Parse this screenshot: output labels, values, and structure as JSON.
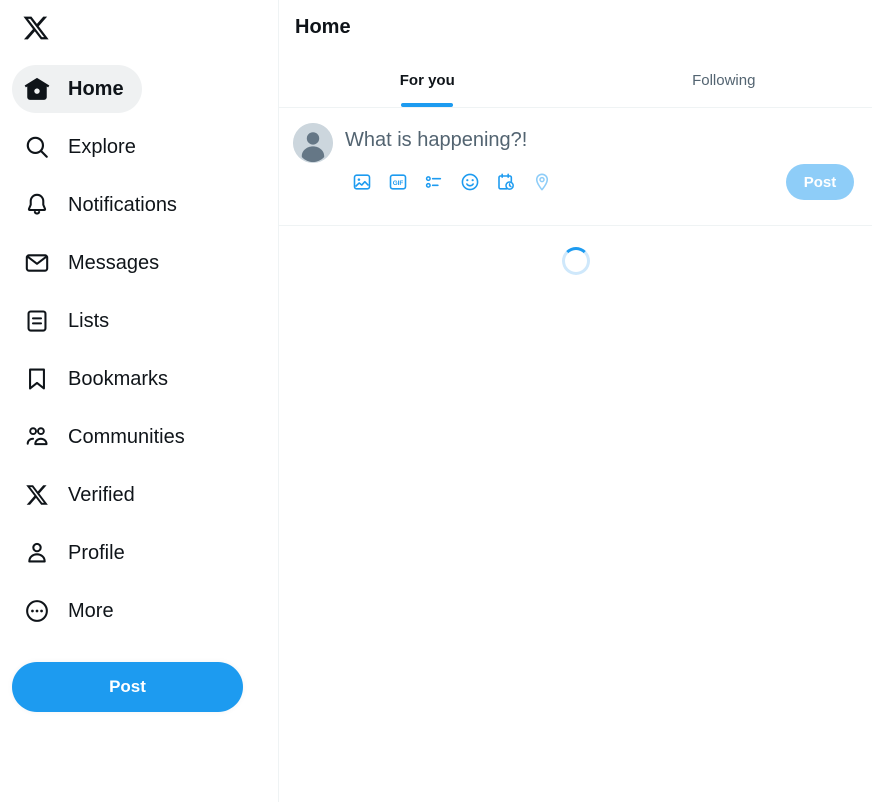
{
  "app": {
    "brand_icon": "x-logo-icon",
    "accent_color": "#1d9bf0",
    "accent_muted_color": "#8ecdf8",
    "text_color": "#0f1419",
    "secondary_text_color": "#536471",
    "active_pill_color": "#eff1f2",
    "divider_color": "#eff3f4"
  },
  "sidebar": {
    "items": [
      {
        "label": "Home",
        "icon": "home-icon",
        "active": true
      },
      {
        "label": "Explore",
        "icon": "search-icon",
        "active": false
      },
      {
        "label": "Notifications",
        "icon": "bell-icon",
        "active": false
      },
      {
        "label": "Messages",
        "icon": "envelope-icon",
        "active": false
      },
      {
        "label": "Lists",
        "icon": "list-icon",
        "active": false
      },
      {
        "label": "Bookmarks",
        "icon": "bookmark-icon",
        "active": false
      },
      {
        "label": "Communities",
        "icon": "communities-icon",
        "active": false
      },
      {
        "label": "Verified",
        "icon": "x-badge-icon",
        "active": false
      },
      {
        "label": "Profile",
        "icon": "person-icon",
        "active": false
      },
      {
        "label": "More",
        "icon": "more-circle-icon",
        "active": false
      }
    ],
    "post_button_label": "Post"
  },
  "main": {
    "header": {
      "title": "Home"
    },
    "tabs": [
      {
        "label": "For you",
        "active": true
      },
      {
        "label": "Following",
        "active": false
      }
    ],
    "compose": {
      "avatar_icon": "default-avatar-icon",
      "placeholder": "What is happening?!",
      "value": "",
      "tools": [
        {
          "name": "media-icon",
          "label": "Media",
          "disabled": false
        },
        {
          "name": "gif-icon",
          "label": "GIF",
          "disabled": false
        },
        {
          "name": "poll-icon",
          "label": "Poll",
          "disabled": false
        },
        {
          "name": "emoji-icon",
          "label": "Emoji",
          "disabled": false
        },
        {
          "name": "schedule-icon",
          "label": "Schedule",
          "disabled": false
        },
        {
          "name": "location-icon",
          "label": "Tag location",
          "disabled": true
        }
      ],
      "post_button_label": "Post",
      "post_button_enabled": false
    },
    "feed": {
      "status": "loading",
      "spinner_icon": "loading-spinner-icon"
    }
  }
}
